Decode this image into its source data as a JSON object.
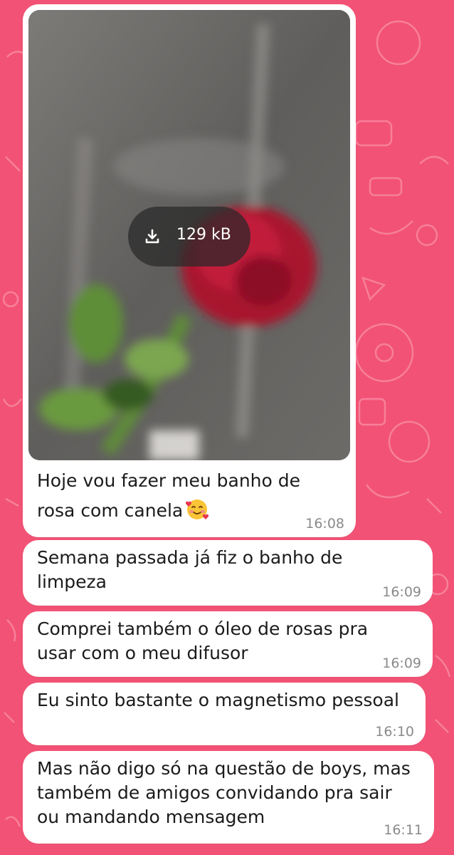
{
  "chat": {
    "accent_color": "#f25275",
    "messages": [
      {
        "type": "image",
        "image": {
          "download_size": "129 kB",
          "description_icon": "download-icon"
        },
        "caption": "Hoje vou fazer meu banho de\nrosa com canela",
        "emoji": "smiling-face-with-hearts",
        "time": "16:08"
      },
      {
        "type": "text",
        "text": "Semana passada já fiz o banho de\nlimpeza",
        "time": "16:09"
      },
      {
        "type": "text",
        "text": "Comprei também o óleo de rosas pra\nusar com o meu difusor",
        "time": "16:09"
      },
      {
        "type": "text",
        "text": "Eu sinto bastante o magnetismo pessoal",
        "time": "16:10"
      },
      {
        "type": "text",
        "text": "Mas não digo só na questão de boys, mas\ntambém de amigos convidando pra sair\nou mandando mensagem",
        "time": "16:11"
      }
    ]
  }
}
